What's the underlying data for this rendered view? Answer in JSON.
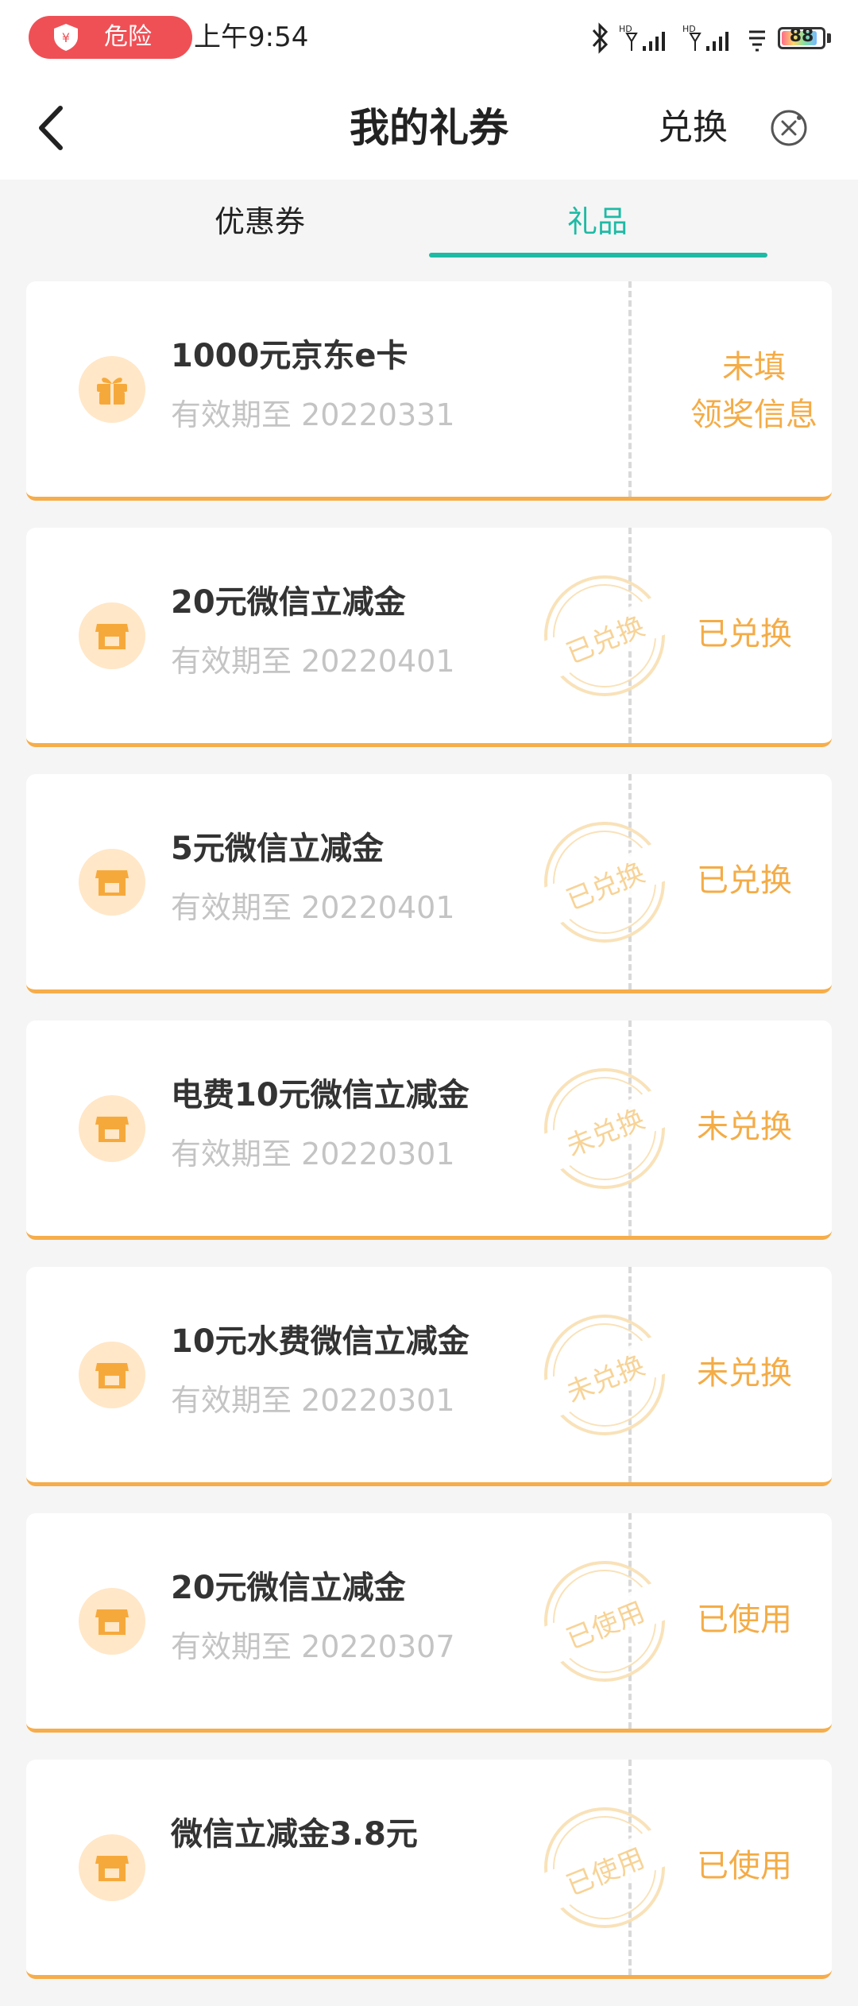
{
  "status_bar": {
    "danger_label": "危险",
    "time": "上午9:54",
    "battery_level": "88"
  },
  "header": {
    "title": "我的礼券",
    "exchange_label": "兑换"
  },
  "tabs": [
    {
      "label": "优惠券",
      "active": false
    },
    {
      "label": "礼品",
      "active": true
    }
  ],
  "colors": {
    "accent": "#1ebaa5",
    "orange": "#f4ac47",
    "danger": "#ef5056"
  },
  "gifts": [
    {
      "name": "1000元京东e卡",
      "expiry": "有效期至 20220331",
      "status_line1": "未填",
      "status_line2": "领奖信息",
      "icon": "gift-icon"
    },
    {
      "name": "20元微信立减金",
      "expiry": "有效期至 20220401",
      "status": "已兑换",
      "stamp": "已兑换",
      "icon": "shop-icon"
    },
    {
      "name": "5元微信立减金",
      "expiry": "有效期至 20220401",
      "status": "已兑换",
      "stamp": "已兑换",
      "icon": "shop-icon"
    },
    {
      "name": "电费10元微信立减金",
      "expiry": "有效期至 20220301",
      "status": "未兑换",
      "stamp": "未兑换",
      "icon": "shop-icon"
    },
    {
      "name": "10元水费微信立减金",
      "expiry": "有效期至 20220301",
      "status": "未兑换",
      "stamp": "未兑换",
      "icon": "shop-icon"
    },
    {
      "name": "20元微信立减金",
      "expiry": "有效期至 20220307",
      "status": "已使用",
      "stamp": "已使用",
      "icon": "shop-icon"
    },
    {
      "name": "微信立减金3.8元",
      "expiry": "",
      "status": "已使用",
      "stamp": "已使用",
      "icon": "shop-icon"
    }
  ]
}
